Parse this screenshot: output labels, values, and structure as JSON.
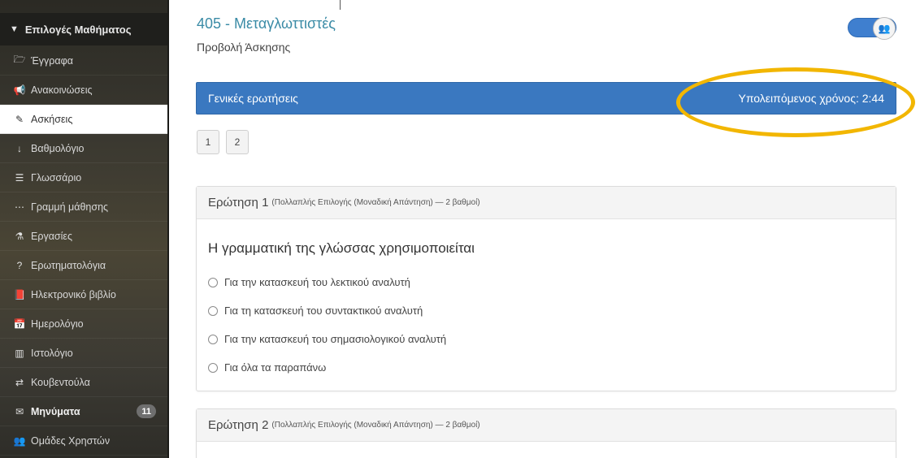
{
  "sidebar": {
    "header": "Επιλογές Μαθήματος",
    "items": [
      {
        "label": "Έγγραφα",
        "icon": "folder-open-icon",
        "glyph": "🗁"
      },
      {
        "label": "Ανακοινώσεις",
        "icon": "bullhorn-icon",
        "glyph": "📢"
      },
      {
        "label": "Ασκήσεις",
        "icon": "edit-icon",
        "glyph": "✎",
        "active": true
      },
      {
        "label": "Βαθμολόγιο",
        "icon": "sort-numeric-icon",
        "glyph": "↓"
      },
      {
        "label": "Γλωσσάριο",
        "icon": "list-icon",
        "glyph": "☰"
      },
      {
        "label": "Γραμμή μάθησης",
        "icon": "ellipsis-icon",
        "glyph": "⋯"
      },
      {
        "label": "Εργασίες",
        "icon": "flask-icon",
        "glyph": "⚗"
      },
      {
        "label": "Ερωτηματολόγια",
        "icon": "question-circle-icon",
        "glyph": "?"
      },
      {
        "label": "Ηλεκτρονικό βιβλίο",
        "icon": "book-icon",
        "glyph": "📕"
      },
      {
        "label": "Ημερολόγιο",
        "icon": "calendar-icon",
        "glyph": "📅"
      },
      {
        "label": "Ιστολόγιο",
        "icon": "columns-icon",
        "glyph": "▥"
      },
      {
        "label": "Κουβεντούλα",
        "icon": "exchange-icon",
        "glyph": "⇄"
      },
      {
        "label": "Μηνύματα",
        "icon": "envelope-icon",
        "glyph": "✉",
        "bold": true,
        "badge": "11"
      },
      {
        "label": "Ομάδες Χρηστών",
        "icon": "users-icon",
        "glyph": "👥"
      }
    ]
  },
  "header": {
    "course_title": "405 - Μεταγλωττιστές",
    "subtitle": "Προβολή Άσκησης",
    "toggle_icon": "users-icon"
  },
  "exercise_bar": {
    "title": "Γενικές ερωτήσεις",
    "timer": "Υπολειπόμενος χρόνος: 2:44"
  },
  "highlight_color": "#f2b600",
  "pager": [
    "1",
    "2"
  ],
  "questions": [
    {
      "heading": "Ερώτηση 1",
      "meta": "(Πολλαπλής Επιλογής (Μοναδική Απάντηση) — 2 βαθμοί)",
      "text": "Η γραμματική της γλώσσας χρησιμοποιείται",
      "options": [
        "Για την κατασκευή του λεκτικού αναλυτή",
        "Για τη κατασκευή του συντακτικού αναλυτή",
        "Για την κατασκευή του σημασιολογικού αναλυτή",
        "Για όλα τα παραπάνω"
      ]
    },
    {
      "heading": "Ερώτηση 2",
      "meta": "(Πολλαπλής Επιλογής (Μοναδική Απάντηση) — 2 βαθμοί)"
    }
  ]
}
